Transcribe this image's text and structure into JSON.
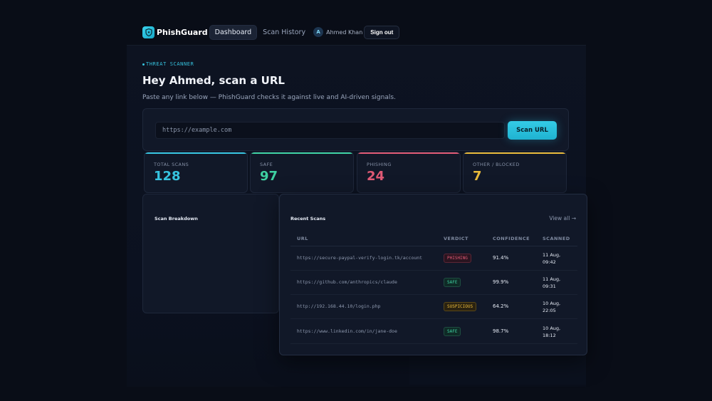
{
  "app": {
    "name": "PhishGuard",
    "accent": "#36c3df"
  },
  "nav": {
    "links": [
      "Dashboard",
      "Scan History"
    ],
    "active": "Dashboard",
    "user_initial": "A",
    "user_name": "Ahmed Khan",
    "signout": "Sign out"
  },
  "hero": {
    "eyebrow": "THREAT SCANNER",
    "title": "Hey Ahmed, scan a URL",
    "subtitle": "Paste any link below — PhishGuard checks it against live and AI-driven signals."
  },
  "scan": {
    "placeholder": "https://example.com",
    "button": "Scan URL"
  },
  "stats": [
    {
      "label": "TOTAL SCANS",
      "value": "128",
      "color": "#36c3df"
    },
    {
      "label": "SAFE",
      "value": "97",
      "color": "#3ed1a2"
    },
    {
      "label": "PHISHING",
      "value": "24",
      "color": "#e05a75"
    },
    {
      "label": "OTHER / BLOCKED",
      "value": "7",
      "color": "#e8b93a"
    }
  ],
  "breakdown": {
    "title": "Scan Breakdown"
  },
  "recent": {
    "title": "Recent Scans",
    "view_all": "View all →",
    "columns": [
      "URL",
      "VERDICT",
      "CONFIDENCE",
      "SCANNED"
    ],
    "rows": [
      {
        "url": "https://secure-paypal-verify-login.tk/account",
        "verdict": "PHISHING",
        "verdict_type": "phishing",
        "confidence": "91.4%",
        "scanned_date": "11 Aug,",
        "scanned_time": "09:42"
      },
      {
        "url": "https://github.com/anthropics/claude",
        "verdict": "SAFE",
        "verdict_type": "safe",
        "confidence": "99.9%",
        "scanned_date": "11 Aug,",
        "scanned_time": "09:31"
      },
      {
        "url": "http://192.168.44.10/login.php",
        "verdict": "SUSPICIOUS",
        "verdict_type": "suspicious",
        "confidence": "64.2%",
        "scanned_date": "10 Aug,",
        "scanned_time": "22:05"
      },
      {
        "url": "https://www.linkedin.com/in/jane-doe",
        "verdict": "SAFE",
        "verdict_type": "safe",
        "confidence": "98.7%",
        "scanned_date": "10 Aug,",
        "scanned_time": "18:12"
      }
    ]
  }
}
